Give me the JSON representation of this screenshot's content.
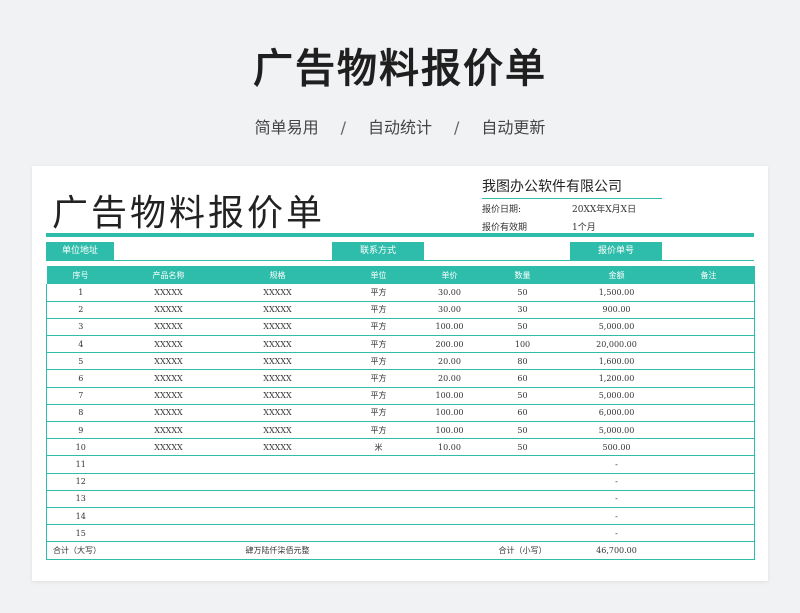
{
  "hero": {
    "title": "广告物料报价单",
    "tags": [
      "简单易用",
      "自动统计",
      "自动更新"
    ],
    "separator": "/"
  },
  "sheet": {
    "title": "广告物料报价单",
    "company": "我图办公软件有限公司",
    "quote_date_label": "报价日期:",
    "quote_date_value": "20XX年X月X日",
    "valid_label": "报价有效期",
    "valid_value": "1个月",
    "info_labels": [
      "单位地址",
      "联系方式",
      "报价单号"
    ],
    "columns": [
      "序号",
      "产品名称",
      "规格",
      "单位",
      "单价",
      "数量",
      "金额",
      "备注"
    ],
    "rows": [
      [
        "1",
        "XXXXX",
        "XXXXX",
        "平方",
        "30.00",
        "50",
        "1,500.00",
        ""
      ],
      [
        "2",
        "XXXXX",
        "XXXXX",
        "平方",
        "30.00",
        "30",
        "900.00",
        ""
      ],
      [
        "3",
        "XXXXX",
        "XXXXX",
        "平方",
        "100.00",
        "50",
        "5,000.00",
        ""
      ],
      [
        "4",
        "XXXXX",
        "XXXXX",
        "平方",
        "200.00",
        "100",
        "20,000.00",
        ""
      ],
      [
        "5",
        "XXXXX",
        "XXXXX",
        "平方",
        "20.00",
        "80",
        "1,600.00",
        ""
      ],
      [
        "6",
        "XXXXX",
        "XXXXX",
        "平方",
        "20.00",
        "60",
        "1,200.00",
        ""
      ],
      [
        "7",
        "XXXXX",
        "XXXXX",
        "平方",
        "100.00",
        "50",
        "5,000.00",
        ""
      ],
      [
        "8",
        "XXXXX",
        "XXXXX",
        "平方",
        "100.00",
        "60",
        "6,000.00",
        ""
      ],
      [
        "9",
        "XXXXX",
        "XXXXX",
        "平方",
        "100.00",
        "50",
        "5,000.00",
        ""
      ],
      [
        "10",
        "XXXXX",
        "XXXXX",
        "米",
        "10.00",
        "50",
        "500.00",
        ""
      ],
      [
        "11",
        "",
        "",
        "",
        "",
        "",
        "-",
        ""
      ],
      [
        "12",
        "",
        "",
        "",
        "",
        "",
        "-",
        ""
      ],
      [
        "13",
        "",
        "",
        "",
        "",
        "",
        "-",
        ""
      ],
      [
        "14",
        "",
        "",
        "",
        "",
        "",
        "-",
        ""
      ],
      [
        "15",
        "",
        "",
        "",
        "",
        "",
        "-",
        ""
      ]
    ],
    "total_upper_label": "合计（大写）",
    "total_upper_value": "肆万陆仟柒佰元整",
    "total_lower_label": "合计（小写）",
    "total_lower_value": "46,700.00"
  },
  "colors": {
    "accent": "#2fbdab"
  }
}
